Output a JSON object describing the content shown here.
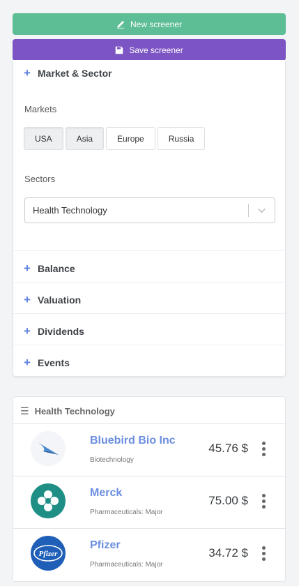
{
  "toolbar": {
    "new_label": "New screener",
    "save_label": "Save screener"
  },
  "filters": {
    "market_sector_title": "Market & Sector",
    "markets_label": "Markets",
    "markets": [
      {
        "label": "USA",
        "selected": true
      },
      {
        "label": "Asia",
        "selected": true
      },
      {
        "label": "Europe",
        "selected": false
      },
      {
        "label": "Russia",
        "selected": false
      }
    ],
    "sectors_label": "Sectors",
    "sector_value": "Health Technology",
    "sections": [
      "Balance",
      "Valuation",
      "Dividends",
      "Events"
    ]
  },
  "list": {
    "title": "Health Technology",
    "items": [
      {
        "name": "Bluebird Bio Inc",
        "industry": "Biotechnology",
        "price": "45.76 $",
        "logo": "bluebird-logo"
      },
      {
        "name": "Merck",
        "industry": "Pharmaceuticals: Major",
        "price": "75.00 $",
        "logo": "merck-logo"
      },
      {
        "name": "Pfizer",
        "industry": "Pharmaceuticals: Major",
        "price": "34.72 $",
        "logo": "pfizer-logo"
      }
    ]
  },
  "colors": {
    "new_button": "#5dbd94",
    "save_button": "#7c54c4",
    "accent": "#5b7fe0",
    "company_name": "#6b8ee0"
  }
}
